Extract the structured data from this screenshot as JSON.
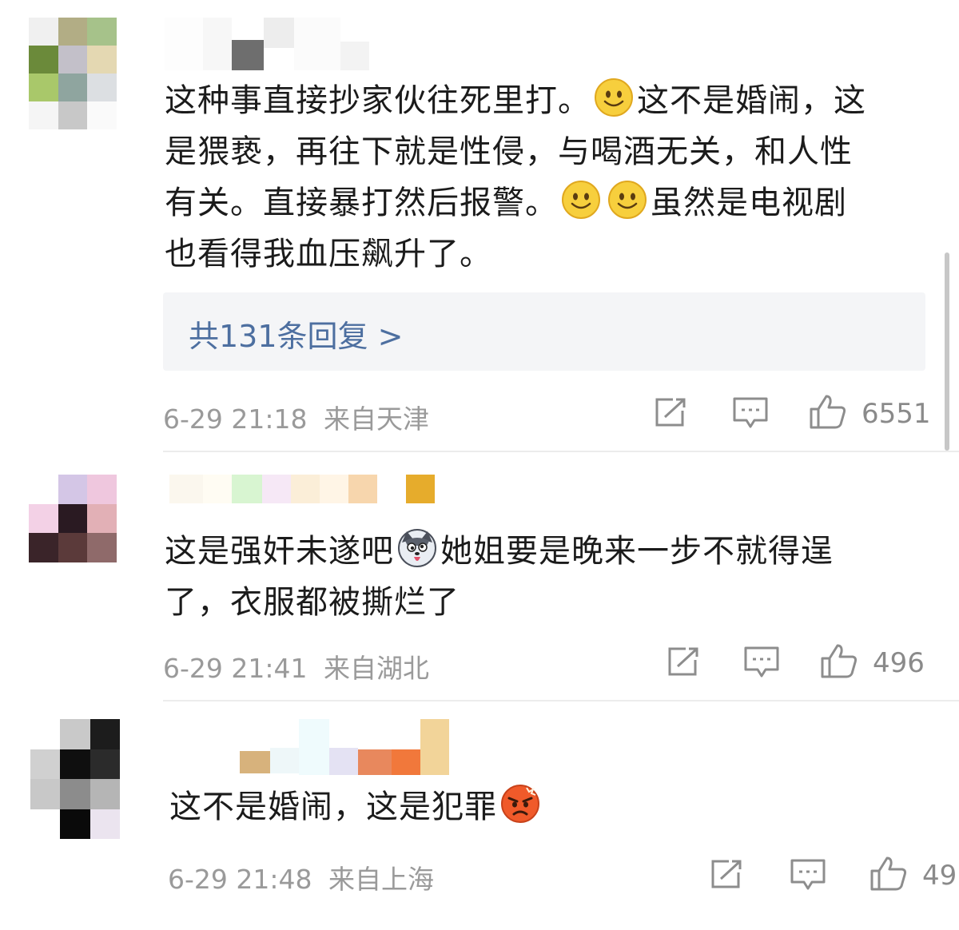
{
  "comments": [
    {
      "avatar_colors": [
        "#f0f0f0",
        "#b2ad85",
        "#a6c28a",
        "#6b8a3a",
        "#c3c0c9",
        "#e4d8b2",
        "#a9c86a",
        "#8fa59f",
        "#dcdfe2",
        "#f5f5f5",
        "#c8c8c8",
        "#fafafa"
      ],
      "text_lines": [
        "这种事直接抄家伙往死里打。",
        "这不是婚闹，这",
        "是猥亵，再往下就是性侵，与喝酒无关，和人性",
        "有关。直接暴打然后报警。",
        "虽然是电视剧",
        "也看得我血压飙升了。"
      ],
      "emojis": [
        "smile-emoji",
        "smile-emoji",
        "smile-emoji"
      ],
      "reply_summary": "共131条回复 >",
      "time": "6-29 21:18",
      "location": "来自天津",
      "likes": "6551"
    },
    {
      "avatar_colors": [
        "#ffffff",
        "#d4c6e6",
        "#efc7de",
        "#f3d1e6",
        "#2a1a22",
        "#e2b0b6",
        "#3a2429",
        "#5b3a3a",
        "#8f6a6a"
      ],
      "text_lines": [
        "这是强奸未遂吧",
        "她姐要是晚来一步不就得逞",
        "了，衣服都被撕烂了"
      ],
      "emojis": [
        "husky-emoji"
      ],
      "time": "6-29 21:41",
      "location": "来自湖北",
      "likes": "496"
    },
    {
      "avatar_colors": [
        "#ffffff",
        "#c9c9c9",
        "#1c1c1c",
        "#d0d0d0",
        "#0f0f0f",
        "#2b2b2b",
        "#c8c8c8",
        "#8c8c8c",
        "#b5b5b5",
        "#ffffff",
        "#0a0a0a",
        "#ebe4ef"
      ],
      "text_lines": [
        "这不是婚闹，这是犯罪"
      ],
      "emojis": [
        "angry-emoji"
      ],
      "time": "6-29 21:48",
      "location": "来自上海",
      "likes": "49"
    }
  ],
  "icons": {
    "share": "share-icon",
    "comment": "comment-icon",
    "like": "thumbs-up-icon"
  },
  "colors": {
    "link": "#4d6fa0",
    "meta": "#9a9a9a",
    "reply_bg": "#f4f5f7"
  }
}
